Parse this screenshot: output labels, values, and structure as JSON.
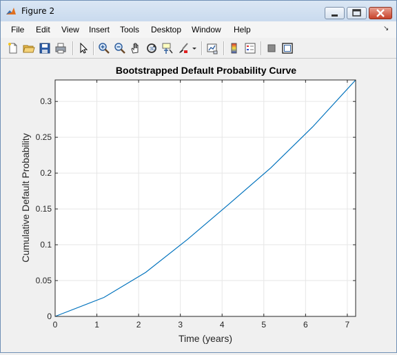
{
  "window": {
    "title": "Figure 2"
  },
  "menubar": {
    "items": [
      "File",
      "Edit",
      "View",
      "Insert",
      "Tools",
      "Desktop",
      "Window",
      "Help"
    ]
  },
  "toolbar": {
    "buttons": [
      "new-figure-icon",
      "open-icon",
      "save-icon",
      "print-icon",
      "select-arrow-icon",
      "zoom-in-icon",
      "zoom-out-icon",
      "pan-hand-icon",
      "rotate-3d-icon",
      "data-cursor-icon",
      "brush-icon",
      "brush-dropdown-icon",
      "link-plot-icon",
      "colorbar-icon",
      "legend-icon",
      "hide-tools-icon",
      "show-tools-icon"
    ]
  },
  "colors": {
    "line": "#0072bd",
    "grid": "#e6e6e6",
    "axes": "#262626"
  },
  "chart_data": {
    "type": "line",
    "title": "Bootstrapped Default Probability Curve",
    "xlabel": "Time (years)",
    "ylabel": "Cumulative Default Probability",
    "xlim": [
      0,
      7.2
    ],
    "ylim": [
      0,
      0.33
    ],
    "xticks": [
      0,
      1,
      2,
      3,
      4,
      5,
      6,
      7
    ],
    "yticks": [
      0,
      0.05,
      0.1,
      0.15,
      0.2,
      0.25,
      0.3
    ],
    "xtick_labels": [
      "0",
      "1",
      "2",
      "3",
      "4",
      "5",
      "6",
      "7"
    ],
    "ytick_labels": [
      "0",
      "0.05",
      "0.1",
      "0.15",
      "0.2",
      "0.25",
      "0.3"
    ],
    "grid": true,
    "series": [
      {
        "x": [
          0,
          1.17,
          2.17,
          3.17,
          4.17,
          5.17,
          6.17,
          7.2
        ],
        "y": [
          0,
          0.0265,
          0.0615,
          0.1075,
          0.157,
          0.2075,
          0.2645,
          0.33
        ]
      }
    ]
  }
}
